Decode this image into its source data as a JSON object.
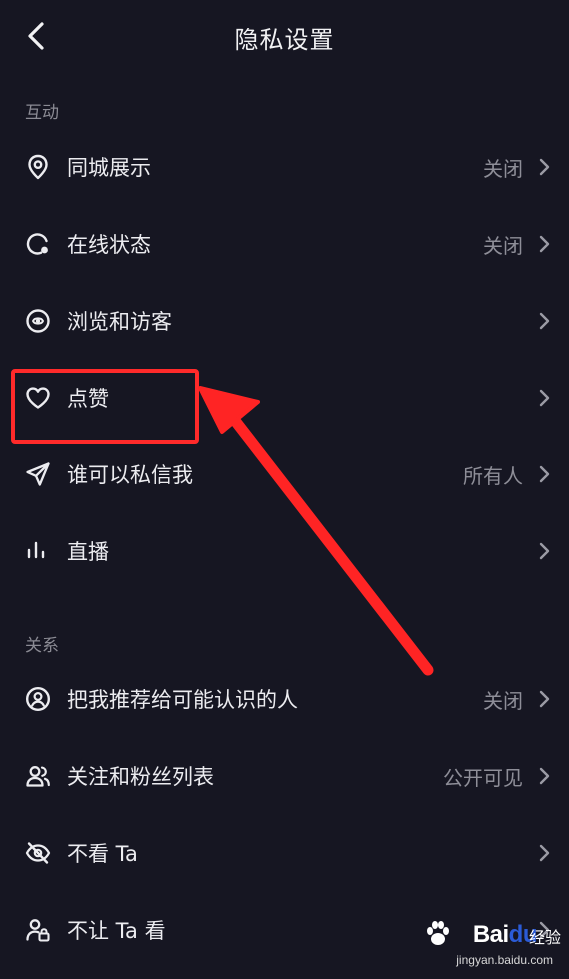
{
  "header": {
    "title": "隐私设置"
  },
  "sections": [
    {
      "title": "互动",
      "items": [
        {
          "label": "同城展示",
          "value": "关闭",
          "icon": "location-pin-icon"
        },
        {
          "label": "在线状态",
          "value": "关闭",
          "icon": "online-status-icon"
        },
        {
          "label": "浏览和访客",
          "value": "",
          "icon": "eye-icon"
        },
        {
          "label": "点赞",
          "value": "",
          "icon": "heart-icon"
        },
        {
          "label": "谁可以私信我",
          "value": "所有人",
          "icon": "send-icon"
        },
        {
          "label": "直播",
          "value": "",
          "icon": "live-bars-icon"
        }
      ]
    },
    {
      "title": "关系",
      "items": [
        {
          "label": "把我推荐给可能认识的人",
          "value": "关闭",
          "icon": "user-circle-icon"
        },
        {
          "label": "关注和粉丝列表",
          "value": "公开可见",
          "icon": "users-icon"
        },
        {
          "label": "不看 Ta",
          "value": "",
          "icon": "eye-off-icon"
        },
        {
          "label": "不让 Ta 看",
          "value": "",
          "icon": "user-lock-icon"
        }
      ]
    }
  ],
  "annotation": {
    "color": "#ff2a2a"
  },
  "watermark": {
    "brand": "Bai",
    "brand_du": "du",
    "brand_jy": "经验",
    "url": "jingyan.baidu.com"
  },
  "colors": {
    "background": "#161622",
    "text": "#ececf0",
    "secondary": "#8e8e98"
  }
}
